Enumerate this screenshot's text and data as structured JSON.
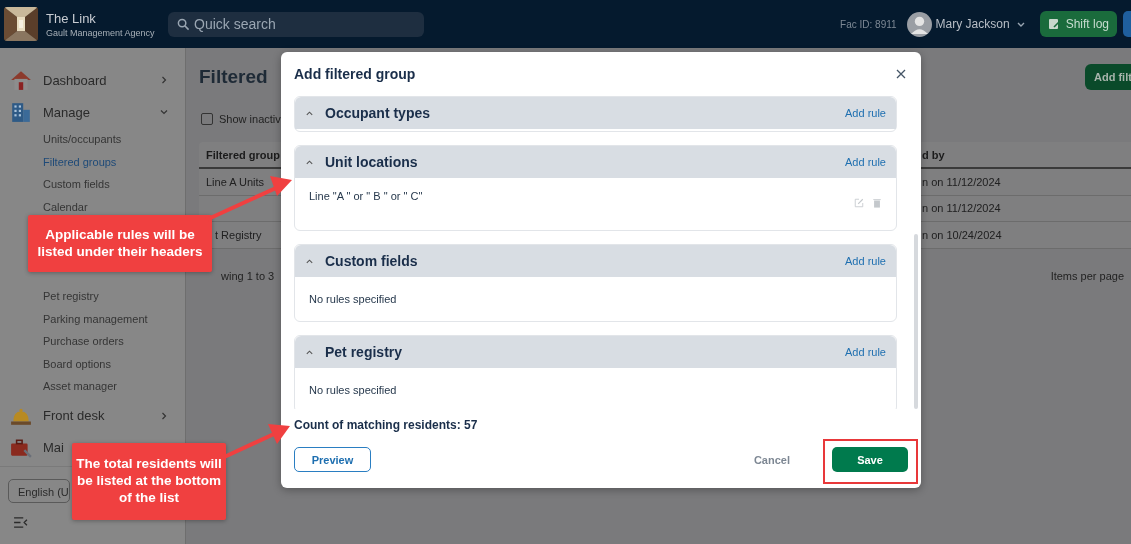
{
  "header": {
    "app_name": "The Link",
    "agency": "Gault Management Agency",
    "search": {
      "placeholder": "Quick search"
    },
    "fac_id": "Fac ID: 8911",
    "user": "Mary Jackson",
    "shift_log": "Shift log"
  },
  "sidebar": {
    "items": [
      {
        "label": "Dashboard",
        "expanded": false
      },
      {
        "label": "Manage",
        "expanded": true,
        "children": [
          {
            "label": "Units/occupants",
            "selected": false
          },
          {
            "label": "Filtered groups",
            "selected": true
          },
          {
            "label": "Custom fields",
            "selected": false
          },
          {
            "label": "Calendar",
            "selected": false
          },
          {
            "label": "Pet registry",
            "selected": false
          },
          {
            "label": "Parking management",
            "selected": false
          },
          {
            "label": "Purchase orders",
            "selected": false
          },
          {
            "label": "Board options",
            "selected": false
          },
          {
            "label": "Asset manager",
            "selected": false
          }
        ]
      },
      {
        "label": "Front desk",
        "expanded": false
      },
      {
        "label": "Mai"
      }
    ],
    "language": "English (U"
  },
  "page": {
    "title": "Filtered",
    "add_button": "Add filt",
    "show_inactive": {
      "label": "Show inactiv",
      "checked": false
    },
    "table": {
      "columns": [
        "Filtered group",
        "d by"
      ],
      "rows": [
        {
          "name": "Line A Units",
          "updated": "n on 11/12/2024"
        },
        {
          "updated": "n on 11/12/2024"
        },
        {
          "name": "t Registry",
          "updated": "n on 10/24/2024"
        }
      ]
    },
    "showing": "wing 1 to 3",
    "items_per_page": "Items per page"
  },
  "modal": {
    "title": "Add filtered group",
    "sections": [
      {
        "title": "Occupant types",
        "add_rule": "Add rule",
        "expanded": true
      },
      {
        "title": "Unit locations",
        "add_rule": "Add rule",
        "expanded": true,
        "rules": [
          {
            "text": "Line \"A \" or \" B \" or \" C\""
          }
        ]
      },
      {
        "title": "Custom fields",
        "add_rule": "Add rule",
        "expanded": true,
        "empty_text": "No rules specified"
      },
      {
        "title": "Pet registry",
        "add_rule": "Add rule",
        "expanded": true,
        "empty_text": "No rules specified"
      }
    ],
    "count": "Count of matching residents: 57",
    "preview": "Preview",
    "cancel": "Cancel",
    "save": "Save"
  },
  "callouts": [
    {
      "text": "Applicable rules will be listed under their headers"
    },
    {
      "text": "The total residents will be listed at the bottom of the list"
    }
  ]
}
